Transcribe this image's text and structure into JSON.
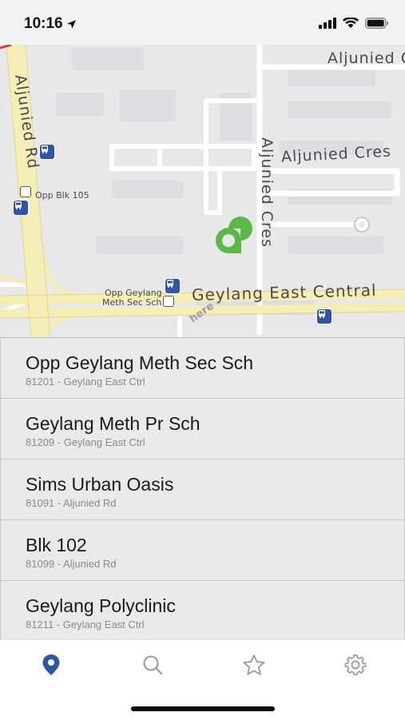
{
  "status_bar": {
    "time": "10:16"
  },
  "map": {
    "roads": {
      "aljunied_cres_top": "Aljunied Cr",
      "aljunied_rd": "Aljunied Rd",
      "aljunied_cres_mid": "Aljunied Cres",
      "aljunied_cres_vert": "Aljunied Cres",
      "geylang_east_central": "Geylang East Central"
    },
    "stops": {
      "opp_blk_105": "Opp Blk 105",
      "opp_geylang_line1": "Opp Geylang",
      "opp_geylang_line2": "Meth Sec Sch"
    },
    "watermark": "here",
    "colors": {
      "location_pin": "#5cb846",
      "bus_stop": "#2f56a6"
    }
  },
  "bus_stops": [
    {
      "name": "Opp Geylang Meth Sec Sch",
      "detail": "81201 - Geylang East Ctrl"
    },
    {
      "name": "Geylang Meth Pr Sch",
      "detail": "81209 - Geylang East Ctrl"
    },
    {
      "name": "Sims Urban Oasis",
      "detail": "81091 - Aljunied Rd"
    },
    {
      "name": "Blk 102",
      "detail": "81099 - Aljunied Rd"
    },
    {
      "name": "Geylang Polyclinic",
      "detail": "81211 - Geylang East Ctrl"
    }
  ],
  "tabbar": {
    "active_color": "#2f56a6",
    "inactive_color": "#9a9a9a",
    "tabs": [
      {
        "icon": "map-pin-icon",
        "active": true
      },
      {
        "icon": "search-icon",
        "active": false
      },
      {
        "icon": "star-icon",
        "active": false
      },
      {
        "icon": "gear-icon",
        "active": false
      }
    ]
  }
}
